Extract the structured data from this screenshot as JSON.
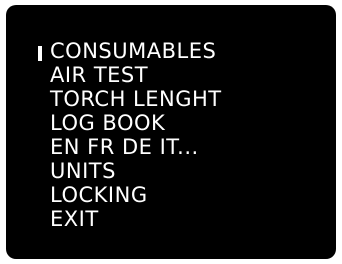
{
  "menu": {
    "selected_index": 0,
    "items": [
      {
        "label": "CONSUMABLES"
      },
      {
        "label": "AIR TEST"
      },
      {
        "label": "TORCH LENGHT"
      },
      {
        "label": "LOG BOOK"
      },
      {
        "label": "EN FR DE IT..."
      },
      {
        "label": "UNITS"
      },
      {
        "label": "LOCKING"
      },
      {
        "label": "EXIT"
      }
    ]
  },
  "colors": {
    "background": "#000000",
    "text": "#ffffff"
  }
}
